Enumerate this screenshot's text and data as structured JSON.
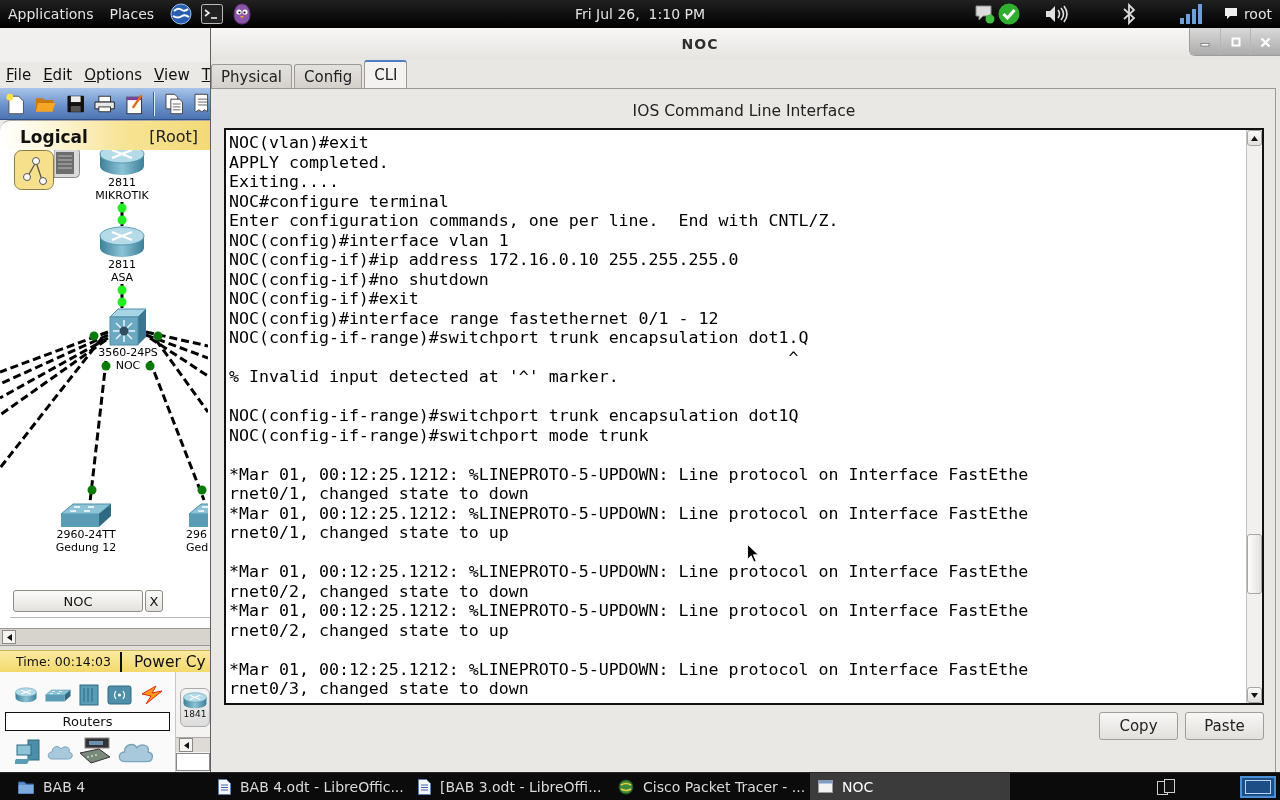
{
  "top_panel": {
    "menus": [
      "Applications",
      "Places"
    ],
    "clock": "Fri Jul 26,  1:10 PM",
    "user": "root"
  },
  "background_app": {
    "menu": [
      "File",
      "Edit",
      "Options",
      "View",
      "T"
    ],
    "workspace": {
      "view": "Logical",
      "path": "[Root]"
    },
    "devices": [
      {
        "kind": "router",
        "model": "2811",
        "name": "MIKROTIK"
      },
      {
        "kind": "router",
        "model": "2811",
        "name": "ASA"
      },
      {
        "kind": "multilayer_switch",
        "model": "3560-24PS",
        "name": "NOC"
      },
      {
        "kind": "switch",
        "model": "2960-24TT",
        "name": "Gedung 12"
      },
      {
        "kind": "switch",
        "model": "296",
        "name": "Ged"
      }
    ],
    "open_device": {
      "label": "NOC",
      "close": "X"
    },
    "status": {
      "time": "Time: 00:14:03",
      "power_cycle": "Power Cy"
    },
    "palette": {
      "category": "Routers",
      "model": "1841"
    }
  },
  "window": {
    "title": "NOC",
    "tabs": [
      {
        "label": "Physical",
        "selected": false
      },
      {
        "label": "Config",
        "selected": false
      },
      {
        "label": "CLI",
        "selected": true
      }
    ],
    "heading": "IOS Command Line Interface",
    "terminal": [
      [
        "NOC(vlan)#exit",
        "APPLY completed.",
        "Exiting....",
        "NOC#configure terminal",
        "Enter configuration commands, one per line.  End with CNTL/Z.",
        "NOC(config)#interface vlan 1",
        "NOC(config-if)#ip address 172.16.0.10 255.255.255.0",
        "NOC(config-if)#no shutdown",
        "NOC(config-if)#exit",
        "NOC(config)#interface range fastethernet 0/1 - 12",
        "NOC(config-if-range)#switchport trunk encapsulation dot1.Q",
        "                                                        ^",
        "% Invalid input detected at '^' marker."
      ],
      [
        "NOC(config-if-range)#switchport trunk encapsulation dot1Q",
        "NOC(config-if-range)#switchport mode trunk"
      ],
      [
        "*Mar 01, 00:12:25.1212: %LINEPROTO-5-UPDOWN: Line protocol on Interface FastEthe",
        "rnet0/1, changed state to down",
        "*Mar 01, 00:12:25.1212: %LINEPROTO-5-UPDOWN: Line protocol on Interface FastEthe",
        "rnet0/1, changed state to up"
      ],
      [
        "*Mar 01, 00:12:25.1212: %LINEPROTO-5-UPDOWN: Line protocol on Interface FastEthe",
        "rnet0/2, changed state to down",
        "*Mar 01, 00:12:25.1212: %LINEPROTO-5-UPDOWN: Line protocol on Interface FastEthe",
        "rnet0/2, changed state to up"
      ],
      [
        "*Mar 01, 00:12:25.1212: %LINEPROTO-5-UPDOWN: Line protocol on Interface FastEthe",
        "rnet0/3, changed state to down"
      ]
    ],
    "buttons": [
      "Copy",
      "Paste"
    ]
  },
  "taskbar": {
    "items": [
      {
        "kind": "folder",
        "label": "BAB 4",
        "selected": false
      },
      {
        "kind": "document",
        "label": "BAB 4.odt - LibreOffic...",
        "selected": false
      },
      {
        "kind": "document",
        "label": "[BAB 3.odt - LibreOffi...",
        "selected": false
      },
      {
        "kind": "application",
        "label": "Cisco Packet Tracer - ...",
        "selected": false
      },
      {
        "kind": "window",
        "label": "NOC",
        "selected": true
      }
    ]
  }
}
